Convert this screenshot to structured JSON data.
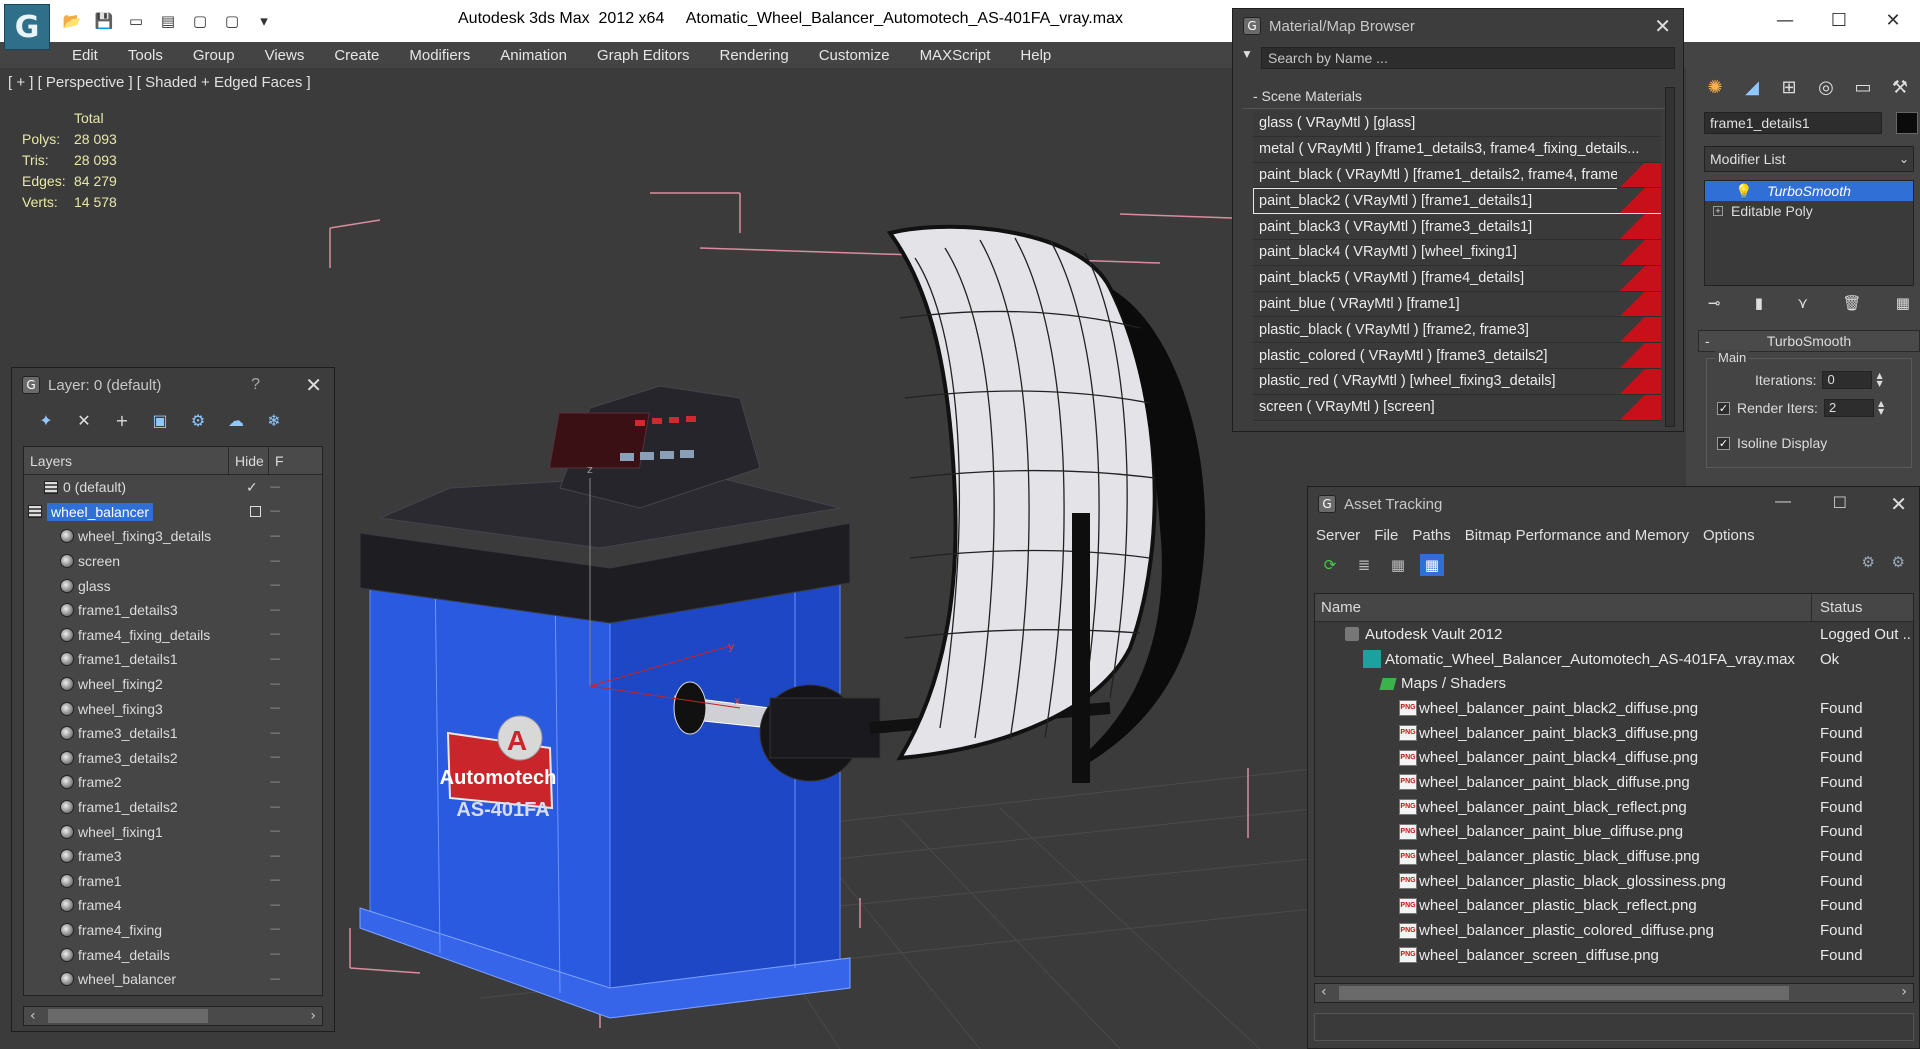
{
  "titlebar": {
    "app_name": "Autodesk 3ds Max  2012 x64",
    "file_name": "Atomatic_Wheel_Balancer_Automotech_AS-401FA_vray.max",
    "qa_icons": [
      "open-icon",
      "save-icon",
      "new-icon",
      "project-icon",
      "undo-icon",
      "redo-icon",
      "dropdown-icon"
    ],
    "minimize": "—",
    "maximize": "☐",
    "close": "✕"
  },
  "menu": [
    "Edit",
    "Tools",
    "Group",
    "Views",
    "Create",
    "Modifiers",
    "Animation",
    "Graph Editors",
    "Rendering",
    "Customize",
    "MAXScript",
    "Help"
  ],
  "viewport": {
    "label": "[ + ] [ Perspective ] [ Shaded + Edged Faces ]",
    "stats_header": "Total",
    "stats": [
      {
        "label": "Polys:",
        "value": "28 093"
      },
      {
        "label": "Tris:",
        "value": "28 093"
      },
      {
        "label": "Edges:",
        "value": "84 279"
      },
      {
        "label": "Verts:",
        "value": "14 578"
      }
    ],
    "brand_text": "Automotech",
    "model_text": "AS-401FA",
    "axis_z": "z",
    "axis_y": "y",
    "axis_x": "x"
  },
  "layer_window": {
    "title": "Layer: 0 (default)",
    "help": "?",
    "close": "✕",
    "toolbar_icons": [
      "new-layer-icon",
      "delete-layer-icon",
      "add-selection-icon",
      "select-objects-icon",
      "highlight-layer-icon",
      "hide-all-icon",
      "freeze-all-icon"
    ],
    "col_layers": "Layers",
    "col_hide": "Hide",
    "col_freeze": "F",
    "rows": [
      {
        "name": "0 (default)",
        "kind": "layer",
        "indent": 1,
        "check": "✓"
      },
      {
        "name": "wheel_balancer",
        "kind": "layer",
        "indent": 0,
        "selected": true
      },
      {
        "name": "wheel_fixing3_details",
        "kind": "obj",
        "indent": 2
      },
      {
        "name": "screen",
        "kind": "obj",
        "indent": 2
      },
      {
        "name": "glass",
        "kind": "obj",
        "indent": 2
      },
      {
        "name": "frame1_details3",
        "kind": "obj",
        "indent": 2
      },
      {
        "name": "frame4_fixing_details",
        "kind": "obj",
        "indent": 2
      },
      {
        "name": "frame1_details1",
        "kind": "obj",
        "indent": 2
      },
      {
        "name": "wheel_fixing2",
        "kind": "obj",
        "indent": 2
      },
      {
        "name": "wheel_fixing3",
        "kind": "obj",
        "indent": 2
      },
      {
        "name": "frame3_details1",
        "kind": "obj",
        "indent": 2
      },
      {
        "name": "frame3_details2",
        "kind": "obj",
        "indent": 2
      },
      {
        "name": "frame2",
        "kind": "obj",
        "indent": 2
      },
      {
        "name": "frame1_details2",
        "kind": "obj",
        "indent": 2
      },
      {
        "name": "wheel_fixing1",
        "kind": "obj",
        "indent": 2
      },
      {
        "name": "frame3",
        "kind": "obj",
        "indent": 2
      },
      {
        "name": "frame1",
        "kind": "obj",
        "indent": 2
      },
      {
        "name": "frame4",
        "kind": "obj",
        "indent": 2
      },
      {
        "name": "frame4_fixing",
        "kind": "obj",
        "indent": 2
      },
      {
        "name": "frame4_details",
        "kind": "obj",
        "indent": 2
      },
      {
        "name": "wheel_balancer",
        "kind": "obj",
        "indent": 2
      }
    ],
    "hide_marker": "----"
  },
  "material_browser": {
    "title": "Material/Map Browser",
    "close": "✕",
    "search_placeholder": "Search by Name ...",
    "group": "- Scene Materials",
    "materials": [
      {
        "text": "glass  ( VRayMtl ) [glass]",
        "red": false
      },
      {
        "text": "metal  ( VRayMtl ) [frame1_details3, frame4_fixing_details...",
        "red": false
      },
      {
        "text": "paint_black  ( VRayMtl ) [frame1_details2, frame4, frame4...",
        "red": true
      },
      {
        "text": "paint_black2  ( VRayMtl ) [frame1_details1]",
        "red": true,
        "selected": true
      },
      {
        "text": "paint_black3  ( VRayMtl ) [frame3_details1]",
        "red": true
      },
      {
        "text": "paint_black4  ( VRayMtl ) [wheel_fixing1]",
        "red": true
      },
      {
        "text": "paint_black5  ( VRayMtl ) [frame4_details]",
        "red": true
      },
      {
        "text": "paint_blue  ( VRayMtl ) [frame1]",
        "red": true
      },
      {
        "text": "plastic_black  ( VRayMtl ) [frame2, frame3]",
        "red": true
      },
      {
        "text": "plastic_colored  ( VRayMtl ) [frame3_details2]",
        "red": true
      },
      {
        "text": "plastic_red  ( VRayMtl ) [wheel_fixing3_details]",
        "red": true
      },
      {
        "text": "screen  ( VRayMtl ) [screen]",
        "red": true
      }
    ]
  },
  "command_panel": {
    "tabs": [
      "create-icon",
      "modify-icon",
      "hierarchy-icon",
      "motion-icon",
      "display-icon",
      "utilities-icon"
    ],
    "object_name": "frame1_details1",
    "modifier_list": "Modifier List",
    "stack": [
      {
        "label": "TurboSmooth",
        "active": true
      },
      {
        "label": "Editable Poly",
        "active": false
      }
    ],
    "rollout_title": "TurboSmooth",
    "group_main": "Main",
    "iterations_label": "Iterations:",
    "iterations_value": "0",
    "render_iters_label": "Render Iters:",
    "render_iters_value": "2",
    "render_iters_checked": true,
    "isoline_label": "Isoline Display",
    "isoline_checked": true
  },
  "asset_tracking": {
    "title": "Asset Tracking",
    "minimize": "—",
    "maximize": "☐",
    "close": "✕",
    "menu": [
      "Server",
      "File",
      "Paths",
      "Bitmap Performance and Memory",
      "Options"
    ],
    "col_name": "Name",
    "col_status": "Status",
    "rows": [
      {
        "name": "Autodesk Vault 2012",
        "status": "Logged Out ..",
        "kind": "vault",
        "indent": 0
      },
      {
        "name": "Atomatic_Wheel_Balancer_Automotech_AS-401FA_vray.max",
        "status": "Ok",
        "kind": "file",
        "indent": 1
      },
      {
        "name": "Maps / Shaders",
        "status": "",
        "kind": "folder",
        "indent": 2
      },
      {
        "name": "wheel_balancer_paint_black2_diffuse.png",
        "status": "Found",
        "kind": "png",
        "indent": 3
      },
      {
        "name": "wheel_balancer_paint_black3_diffuse.png",
        "status": "Found",
        "kind": "png",
        "indent": 3
      },
      {
        "name": "wheel_balancer_paint_black4_diffuse.png",
        "status": "Found",
        "kind": "png",
        "indent": 3
      },
      {
        "name": "wheel_balancer_paint_black_diffuse.png",
        "status": "Found",
        "kind": "png",
        "indent": 3
      },
      {
        "name": "wheel_balancer_paint_black_reflect.png",
        "status": "Found",
        "kind": "png",
        "indent": 3
      },
      {
        "name": "wheel_balancer_paint_blue_diffuse.png",
        "status": "Found",
        "kind": "png",
        "indent": 3
      },
      {
        "name": "wheel_balancer_plastic_black_diffuse.png",
        "status": "Found",
        "kind": "png",
        "indent": 3
      },
      {
        "name": "wheel_balancer_plastic_black_glossiness.png",
        "status": "Found",
        "kind": "png",
        "indent": 3
      },
      {
        "name": "wheel_balancer_plastic_black_reflect.png",
        "status": "Found",
        "kind": "png",
        "indent": 3
      },
      {
        "name": "wheel_balancer_plastic_colored_diffuse.png",
        "status": "Found",
        "kind": "png",
        "indent": 3
      },
      {
        "name": "wheel_balancer_screen_diffuse.png",
        "status": "Found",
        "kind": "png",
        "indent": 3
      }
    ]
  },
  "colors": {
    "selection_blue": "#2f6fd6",
    "material_red": "#c8101a",
    "stats_yellow": "#e8e8a8",
    "model_blue": "#1f55d6"
  }
}
